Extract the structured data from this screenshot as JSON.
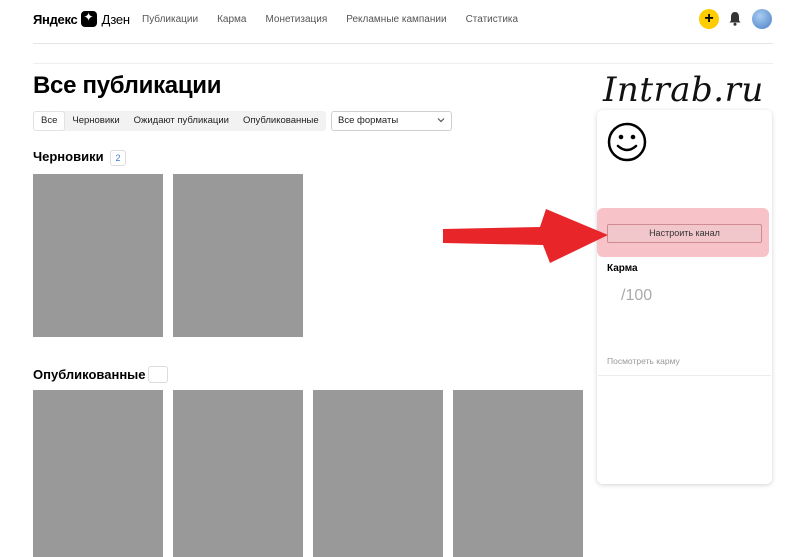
{
  "header": {
    "logo_brand": "Яндекс",
    "logo_product": "Дзен",
    "nav": [
      "Публикации",
      "Карма",
      "Монетизация",
      "Рекламные кампании",
      "Статистика"
    ],
    "plus_label": "+"
  },
  "main": {
    "title": "Все публикации",
    "filters": [
      "Все",
      "Черновики",
      "Ожидают публикации",
      "Опубликованные"
    ],
    "active_filter": "Все",
    "format_select": "Все форматы",
    "drafts": {
      "title": "Черновики",
      "count": "2"
    },
    "published": {
      "title": "Опубликованные",
      "count": ""
    }
  },
  "sidebar": {
    "setup_button": "Настроить канал",
    "karma_title": "Карма",
    "karma_value": "/100",
    "karma_link": "Посмотреть карму"
  },
  "overlay": {
    "watermark": "Intrab.ru",
    "arrow_color": "#e8262a",
    "highlight_color": "#f7c3c8"
  },
  "colors": {
    "accent_yellow": "#ffcc00",
    "placeholder_gray": "#999999",
    "link_blue": "#3a7bd5"
  }
}
